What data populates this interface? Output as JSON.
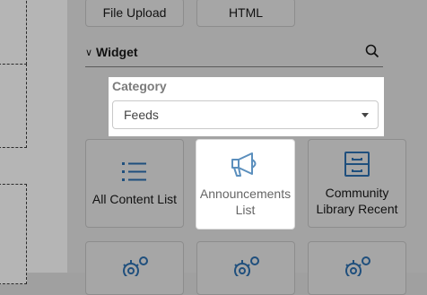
{
  "top_tiles": [
    "File Upload",
    "HTML"
  ],
  "widget_section": {
    "title": "Widget",
    "chevron": "chevron-down-icon",
    "search_icon": "search-icon"
  },
  "category": {
    "label": "Category",
    "value": "Feeds"
  },
  "widgets": [
    {
      "label_line1": "All Content List",
      "label_line2": "",
      "icon": "list-icon",
      "highlighted": false
    },
    {
      "label_line1": "Announcements",
      "label_line2": "List",
      "icon": "megaphone-icon",
      "highlighted": true
    },
    {
      "label_line1": "Community",
      "label_line2": "Library Recent",
      "icon": "file-cabinet-icon",
      "highlighted": false
    }
  ],
  "bottom_tiles_icon": "gear-icon",
  "colors": {
    "accent": "#1f4f7d",
    "accent_highlight": "#5b8fbd"
  }
}
